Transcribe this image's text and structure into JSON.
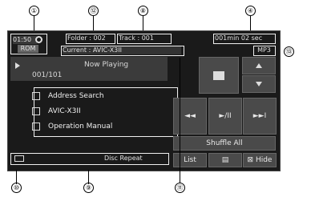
{
  "callouts": {
    "c1": "①",
    "c12": "⑫",
    "c8": "⑧",
    "c4": "④",
    "c13": "⑬",
    "c10": "⑩",
    "c9": "⑨",
    "c11": "⑪"
  },
  "status": {
    "clock": "01:50",
    "source": "ROM",
    "folder": "Folder : 002",
    "track": "Track : 001",
    "elapsed": "001min  02 sec",
    "current": "Current : AVIC-X3II",
    "format": "MP3"
  },
  "now_playing": {
    "label": "Now Playing",
    "track_count": "001/101"
  },
  "list": {
    "items": [
      "Address Search",
      "AVIC-X3II",
      "Operation Manual"
    ]
  },
  "repeat": "Disc Repeat",
  "controls": {
    "shuffle": "Shuffle All",
    "list": "List",
    "hide": "Hide"
  },
  "icons": [
    "folder-icon",
    "up-arrow-icon",
    "down-arrow-icon",
    "prev-icon",
    "play-pause-icon",
    "next-icon",
    "menu-icon",
    "hide-x-icon",
    "repeat-icon",
    "play-icon"
  ]
}
